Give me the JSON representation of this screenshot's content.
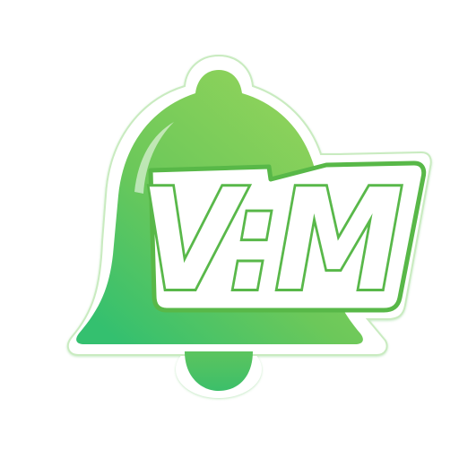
{
  "logo": {
    "icon": "bell-icon",
    "wordmark": "V:M",
    "colors": {
      "bell_light": "#8fd15a",
      "bell_mid": "#6cc85a",
      "bell_dark": "#2fbf72",
      "text_fill": "#ffffff",
      "text_outline": "#59b84a",
      "sticker_border": "#ffffff",
      "sticker_edge": "#bfe8b4"
    }
  }
}
